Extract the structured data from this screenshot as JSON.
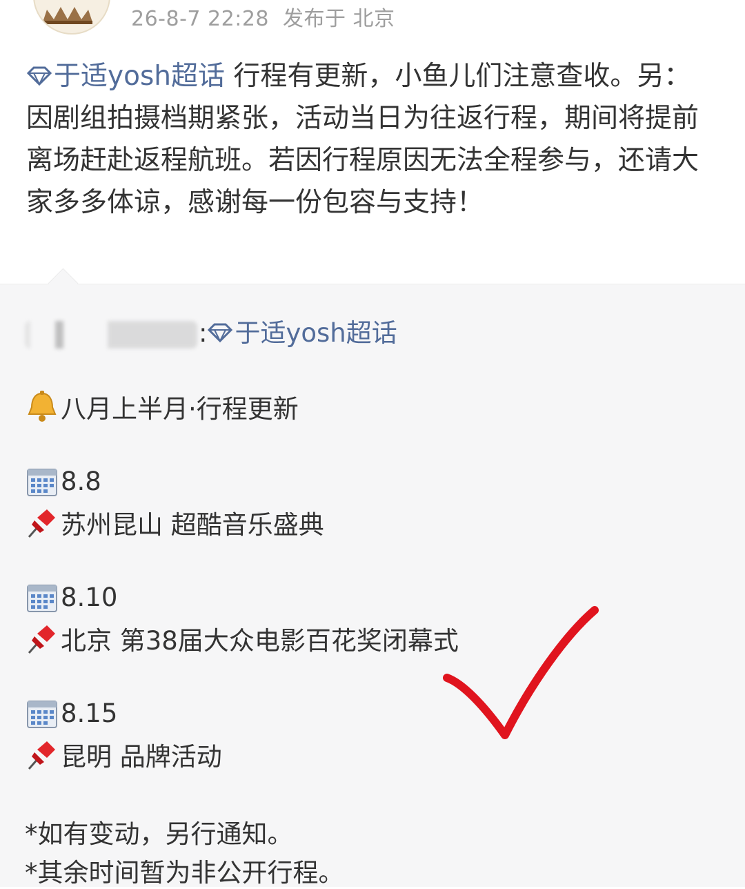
{
  "post": {
    "time": "26-8-7 22:28",
    "location": "发布于 北京",
    "topic": "于适yosh超话",
    "body": " 行程有更新，小鱼儿们注意查收。另：因剧组拍摄档期紧张，活动当日为往返行程，期间将提前离场赶赴返程航班。若因行程原因无法全程参与，还请大家多多体谅，感谢每一份包容与支持！"
  },
  "repost": {
    "colon": ":",
    "topic": "于适yosh超话",
    "heading": "八月上半月·行程更新",
    "schedule": [
      {
        "date": "8.8",
        "event": "苏州昆山 超酷音乐盛典"
      },
      {
        "date": "8.10",
        "event": "北京 第38届大众电影百花奖闭幕式"
      },
      {
        "date": "8.15",
        "event": "昆明 品牌活动"
      }
    ],
    "notes": [
      "*如有变动，另行通知。",
      "*其余时间暂为非公开行程。"
    ]
  },
  "colors": {
    "link": "#526c9a",
    "meta": "#9e9e9e",
    "check": "#e0141e"
  },
  "icons": [
    "avatar",
    "diamond-icon",
    "bell-icon",
    "calendar-icon",
    "pushpin-icon",
    "red-checkmark"
  ]
}
